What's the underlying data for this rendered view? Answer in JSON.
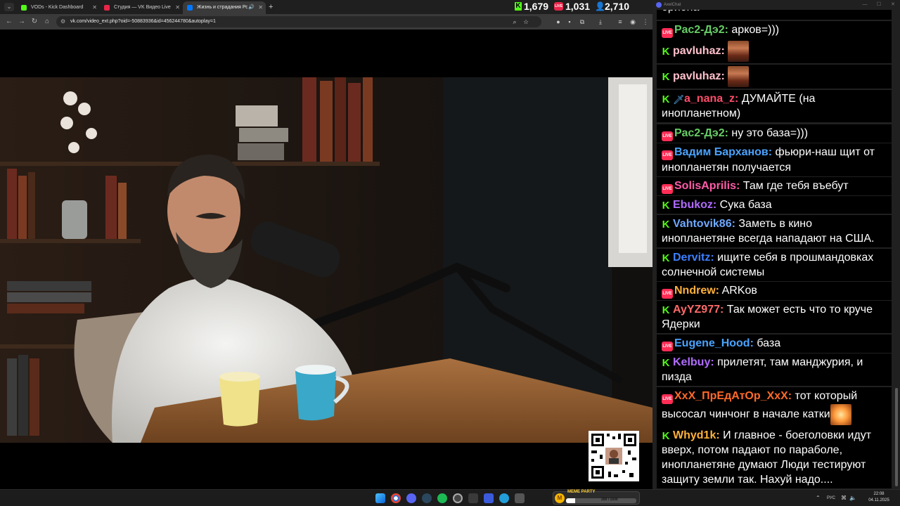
{
  "browser": {
    "tabs": [
      {
        "label": "VODs - Kick Dashboard",
        "color": "#53fc18"
      },
      {
        "label": "Студия — VK Видео Live",
        "color": "#e8264a"
      },
      {
        "label": "Жизнь и страдания Рома...",
        "color": "#0077ff"
      }
    ],
    "url": "vk.com/video_ext.php?oid=-50883936&id=456244780&autoplay=1"
  },
  "stats": {
    "kick_viewers": "1,679",
    "vk_viewers": "1,031",
    "total_viewers": "2,710"
  },
  "chat": {
    "app_title": "AxelChat",
    "first_fragment": "ориона",
    "messages": [
      {
        "platform": "vk",
        "user": "Рас2-Дэ2:",
        "color": "#66cc66",
        "text": " арков=)))"
      },
      {
        "platform": "kick",
        "user": "pavluhaz:",
        "color": "#ffc0cb",
        "text": " ",
        "emote": "face"
      },
      {
        "platform": "kick",
        "user": "pavluhaz:",
        "color": "#ffc0cb",
        "text": " ",
        "emote": "face"
      },
      {
        "platform": "kick",
        "user": "a_nana_z:",
        "color": "#ff4d6a",
        "text": " ДУМАЙТЕ (на инопланетном)",
        "sword": true
      },
      {
        "platform": "vk",
        "user": "Рас2-Дэ2:",
        "color": "#66cc66",
        "text": " ну это база=)))"
      },
      {
        "platform": "vk",
        "user": "Вадим Барханов:",
        "color": "#4aa3ff",
        "text": " фьюри-наш щит от инопланетян получается"
      },
      {
        "platform": "vk",
        "user": "SolisAprilis:",
        "color": "#ff5ca8",
        "text": " Там где тебя въебут"
      },
      {
        "platform": "kick",
        "user": "Ebukoz:",
        "color": "#b06cff",
        "text": " Сука база"
      },
      {
        "platform": "kick",
        "user": "Vahtovik86:",
        "color": "#6fa8ff",
        "text": " Заметь в кино инопланетяне всегда нападают на США."
      },
      {
        "platform": "kick",
        "user": "Dervitz:",
        "color": "#3f7fff",
        "text": " ищите себя в прошмандовках солнечной системы"
      },
      {
        "platform": "vk",
        "user": "Nndrew:",
        "color": "#ffb13b",
        "text": " ARKов"
      },
      {
        "platform": "kick",
        "user": "AyYZ977:",
        "color": "#ff6a6a",
        "text": " Так может есть что то круче Ядерки"
      },
      {
        "platform": "vk",
        "user": "Eugene_Hood:",
        "color": "#4aa3ff",
        "text": " база"
      },
      {
        "platform": "kick",
        "user": "Kelbuy:",
        "color": "#b06cff",
        "text": " прилетят, там манджурия, и пизда"
      },
      {
        "platform": "vk",
        "user": "XxX_ПрЕдАтОр_XxX:",
        "color": "#ff6a2a",
        "text": " тот который высосал чинчонг в начале катки",
        "emote": "fire"
      },
      {
        "platform": "kick",
        "user": "Whyd1k:",
        "color": "#ffb13b",
        "text": " И главное - боеголовки идут вверх, потом падают по параболе, инопланетяне думают Люди тестируют защиту земли так. Нахуй надо...."
      }
    ]
  },
  "taskbar": {
    "widget_title": "МЕМЕ PARTY",
    "widget_progress_text": "200 / 1500",
    "widget_progress_fraction": 0.133,
    "language": "РУС",
    "time": "22:08",
    "date": "04.11.2025"
  }
}
